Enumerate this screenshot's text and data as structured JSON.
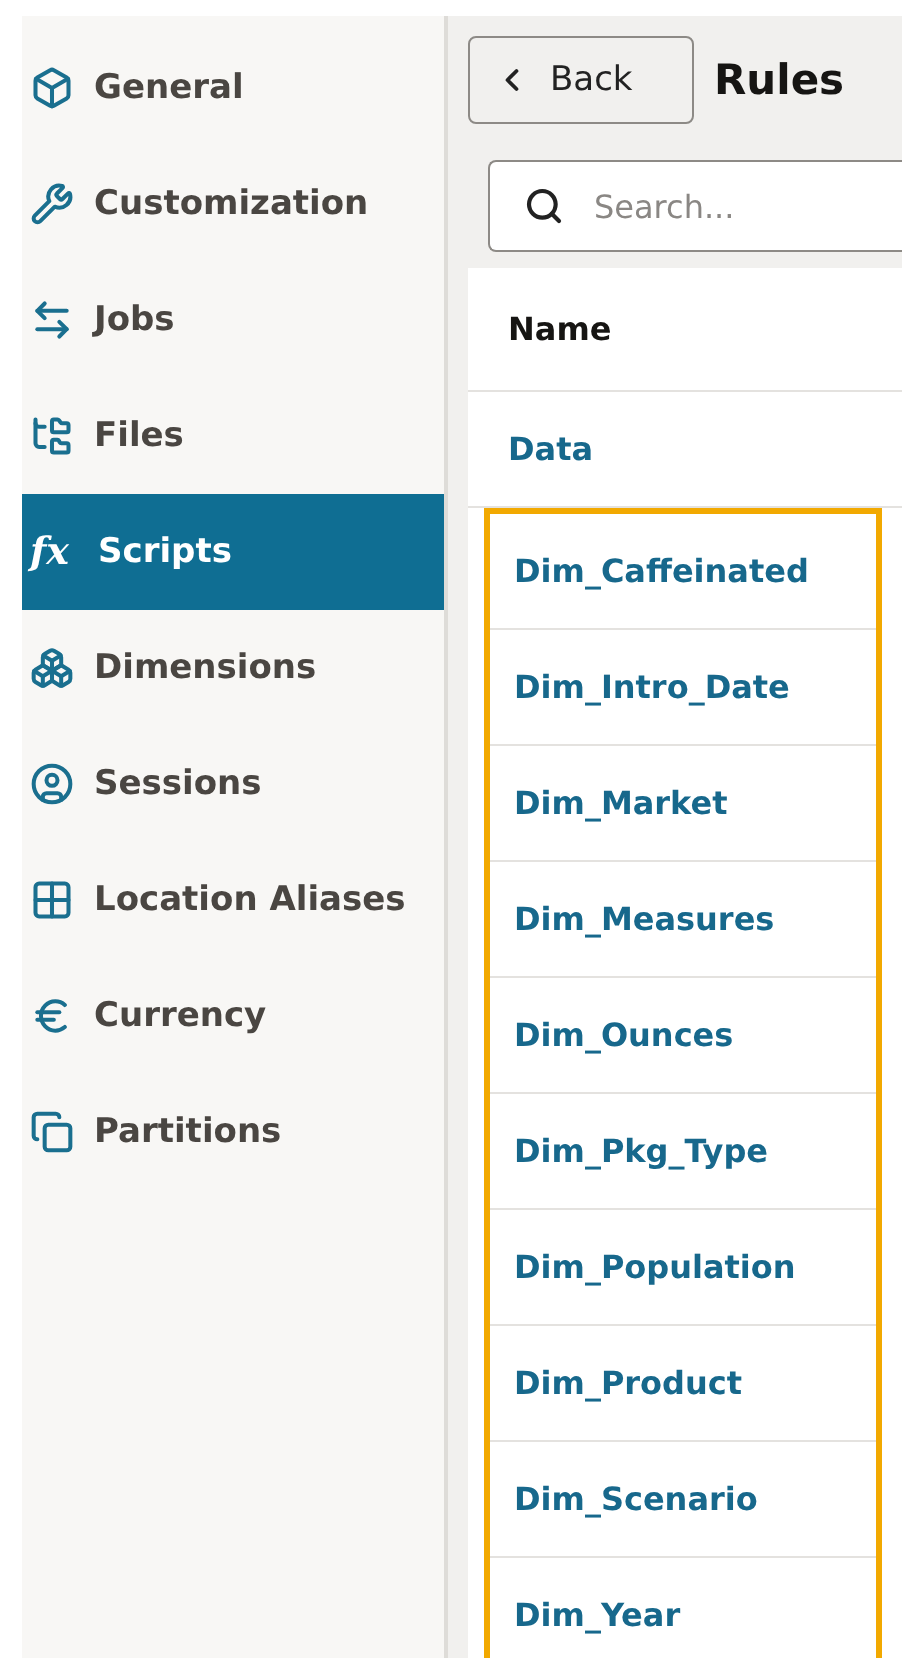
{
  "sidebar": {
    "items": [
      {
        "label": "General",
        "selected": false
      },
      {
        "label": "Customization",
        "selected": false
      },
      {
        "label": "Jobs",
        "selected": false
      },
      {
        "label": "Files",
        "selected": false
      },
      {
        "label": "Scripts",
        "icon_glyph": "fx",
        "selected": true
      },
      {
        "label": "Dimensions",
        "selected": false
      },
      {
        "label": "Sessions",
        "selected": false
      },
      {
        "label": "Location Aliases",
        "selected": false
      },
      {
        "label": "Currency",
        "selected": false
      },
      {
        "label": "Partitions",
        "selected": false
      }
    ]
  },
  "header": {
    "back_button": "Back",
    "title": "Rules"
  },
  "search": {
    "placeholder": "Search..."
  },
  "table": {
    "columns": [
      "Name"
    ],
    "rows": [
      {
        "name": "Data",
        "highlighted": false
      },
      {
        "name": "Dim_Caffeinated",
        "highlighted": true
      },
      {
        "name": "Dim_Intro_Date",
        "highlighted": true
      },
      {
        "name": "Dim_Market",
        "highlighted": true
      },
      {
        "name": "Dim_Measures",
        "highlighted": true
      },
      {
        "name": "Dim_Ounces",
        "highlighted": true
      },
      {
        "name": "Dim_Pkg_Type",
        "highlighted": true
      },
      {
        "name": "Dim_Population",
        "highlighted": true
      },
      {
        "name": "Dim_Product",
        "highlighted": true
      },
      {
        "name": "Dim_Scenario",
        "highlighted": true
      },
      {
        "name": "Dim_Year",
        "highlighted": true
      }
    ]
  }
}
